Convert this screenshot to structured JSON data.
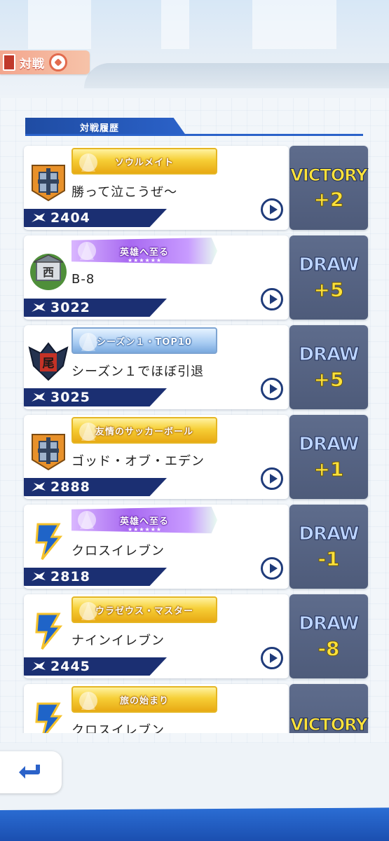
{
  "header": {
    "title": "対戦"
  },
  "section": {
    "title": "対戦履歴"
  },
  "matches": [
    {
      "badge_text": "ソウルメイト",
      "badge_style": "gold",
      "name": "勝って泣こうぜ〜",
      "power": "2404",
      "result": "VICTORY",
      "delta": "+2",
      "emblem": "lightning-emblem"
    },
    {
      "badge_text": "英雄へ至る",
      "badge_style": "purple",
      "name": "B-8",
      "power": "3022",
      "result": "DRAW",
      "delta": "+5",
      "emblem": "laurel-emblem"
    },
    {
      "badge_text": "シーズン１・TOP10",
      "badge_style": "blue",
      "name": "シーズン１でほぼ引退",
      "power": "3025",
      "result": "DRAW",
      "delta": "+5",
      "emblem": "bat-emblem"
    },
    {
      "badge_text": "友情のサッカーボール",
      "badge_style": "gold",
      "name": "ゴッド・オブ・エデン",
      "power": "2888",
      "result": "DRAW",
      "delta": "+1",
      "emblem": "lightning-emblem"
    },
    {
      "badge_text": "英雄へ至る",
      "badge_style": "purple",
      "name": "クロスイレブン",
      "power": "2818",
      "result": "DRAW",
      "delta": "-1",
      "emblem": "inazuma-emblem"
    },
    {
      "badge_text": "ウラゼウス・マスター",
      "badge_style": "gold",
      "name": "ナインイレブン",
      "power": "2445",
      "result": "DRAW",
      "delta": "-8",
      "emblem": "inazuma-emblem"
    },
    {
      "badge_text": "旅の始まり",
      "badge_style": "gold",
      "name": "クロスイレブン",
      "power": "",
      "result": "VICTORY",
      "delta": "",
      "emblem": "inazuma-emblem"
    }
  ],
  "colors": {
    "navy": "#1b2f72",
    "result_bg": "#56648a",
    "victory": "#ffe23a",
    "draw": "#bcd4ff",
    "accent_blue": "#2b62c9"
  }
}
